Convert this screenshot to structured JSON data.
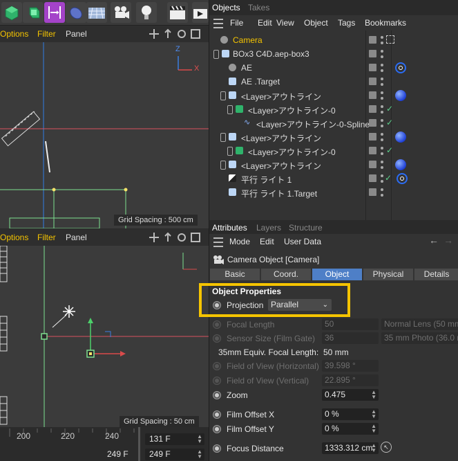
{
  "viewport_top": {
    "menu": [
      "Options",
      "Filter",
      "Panel"
    ],
    "axis_z": "Z",
    "axis_x": "X",
    "grid_spacing": "Grid Spacing : 500 cm"
  },
  "viewport_bottom": {
    "menu": [
      "Options",
      "Filter",
      "Panel"
    ],
    "grid_spacing": "Grid Spacing : 50 cm"
  },
  "timeline": {
    "ruler": [
      "200",
      "220",
      "240"
    ],
    "current_frame": "249 F",
    "start_field": "131 F",
    "end_field": "249 F"
  },
  "objects_panel": {
    "tabs": [
      "Objects",
      "Takes"
    ],
    "menu": [
      "File",
      "Edit",
      "View",
      "Object",
      "Tags",
      "Bookmarks"
    ],
    "rows": [
      {
        "name": "Camera",
        "indent": 0,
        "icon": "camera",
        "highlight": true,
        "tag": "target"
      },
      {
        "name": "BOx3 C4D.aep-box3",
        "indent": 0,
        "icon": "null",
        "tag": ""
      },
      {
        "name": "AE",
        "indent": 1,
        "icon": "camera",
        "tag": "ring"
      },
      {
        "name": "AE .Target",
        "indent": 1,
        "icon": "null",
        "tag": ""
      },
      {
        "name": "<Layer>アウトライン",
        "indent": 1,
        "icon": "null",
        "tag": "sphere"
      },
      {
        "name": "<Layer>アウトライン-0",
        "indent": 2,
        "icon": "cube",
        "tag": "check"
      },
      {
        "name": "<Layer>アウトライン-0-Spline",
        "indent": 3,
        "icon": "spline",
        "tag": "check"
      },
      {
        "name": "<Layer>アウトライン",
        "indent": 1,
        "icon": "null",
        "tag": "sphere"
      },
      {
        "name": "<Layer>アウトライン-0",
        "indent": 2,
        "icon": "cube",
        "tag": "check"
      },
      {
        "name": "<Layer>アウトライン",
        "indent": 1,
        "icon": "null",
        "tag": "sphere"
      },
      {
        "name": "平行 ライト 1",
        "indent": 1,
        "icon": "light",
        "tag": "checkring"
      },
      {
        "name": "平行 ライト 1.Target",
        "indent": 1,
        "icon": "null",
        "tag": ""
      }
    ]
  },
  "attributes_panel": {
    "tabs": [
      "Attributes",
      "Layers",
      "Structure"
    ],
    "menu": [
      "Mode",
      "Edit",
      "User Data"
    ],
    "object_title": "Camera Object [Camera]",
    "prop_tabs": [
      "Basic",
      "Coord.",
      "Object",
      "Physical",
      "Details"
    ],
    "active_prop_tab": "Object",
    "section_title": "Object Properties",
    "projection_label": "Projection",
    "projection_value": "Parallel",
    "properties": [
      {
        "label": "Focal Length",
        "value": "50",
        "extra": "Normal Lens (50 mm",
        "enabled": false,
        "radio": true
      },
      {
        "label": "Sensor Size (Film Gate)",
        "value": "36",
        "extra": "35 mm Photo (36.0 m",
        "enabled": false,
        "radio": true
      },
      {
        "label": "35mm Equiv. Focal Length:",
        "value": "50 mm",
        "enabled": true,
        "radio": false,
        "plain": true
      },
      {
        "label": "Field of View (Horizontal)",
        "value": "39.598 °",
        "enabled": false,
        "radio": true
      },
      {
        "label": "Field of View (Vertical)",
        "value": "22.895 °",
        "enabled": false,
        "radio": true
      },
      {
        "label": "Zoom",
        "value": "0.475",
        "enabled": true,
        "radio": true
      },
      {
        "label": "Film Offset X",
        "value": "0 %",
        "enabled": true,
        "radio": true
      },
      {
        "label": "Film Offset Y",
        "value": "0 %",
        "enabled": true,
        "radio": true
      },
      {
        "label": "Focus Distance",
        "value": "1333.312 cm",
        "enabled": true,
        "radio": true
      }
    ]
  }
}
